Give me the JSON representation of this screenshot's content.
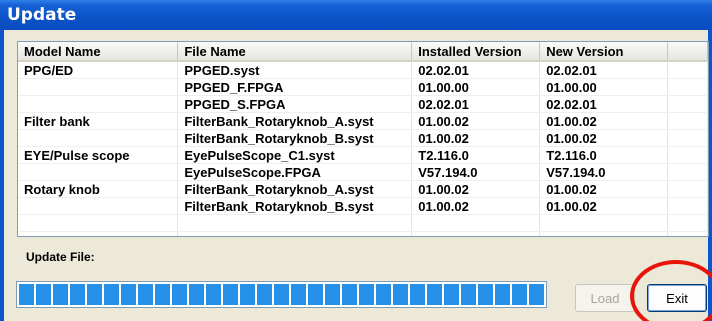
{
  "window": {
    "title": "Update"
  },
  "table": {
    "headers": [
      "Model Name",
      "File Name",
      "Installed Version",
      "New Version"
    ],
    "rows": [
      [
        "PPG/ED",
        "PPGED.syst",
        "02.02.01",
        "02.02.01"
      ],
      [
        "",
        "PPGED_F.FPGA",
        "01.00.00",
        "01.00.00"
      ],
      [
        "",
        "PPGED_S.FPGA",
        "02.02.01",
        "02.02.01"
      ],
      [
        "Filter bank",
        "FilterBank_Rotaryknob_A.syst",
        "01.00.02",
        "01.00.02"
      ],
      [
        "",
        "FilterBank_Rotaryknob_B.syst",
        "01.00.02",
        "01.00.02"
      ],
      [
        "EYE/Pulse scope",
        "EyePulseScope_C1.syst",
        "T2.116.0",
        "T2.116.0"
      ],
      [
        "",
        "EyePulseScope.FPGA",
        "V57.194.0",
        "V57.194.0"
      ],
      [
        "Rotary knob",
        "FilterBank_Rotaryknob_A.syst",
        "01.00.02",
        "01.00.02"
      ],
      [
        "",
        "FilterBank_Rotaryknob_B.syst",
        "01.00.02",
        "01.00.02"
      ],
      [
        "",
        "",
        "",
        ""
      ],
      [
        "",
        "",
        "",
        ""
      ]
    ]
  },
  "update_file": {
    "label": "Update File:",
    "progress": 1.0
  },
  "buttons": {
    "load": "Load",
    "exit": "Exit"
  },
  "annotation": {
    "color": "#e8140a"
  }
}
